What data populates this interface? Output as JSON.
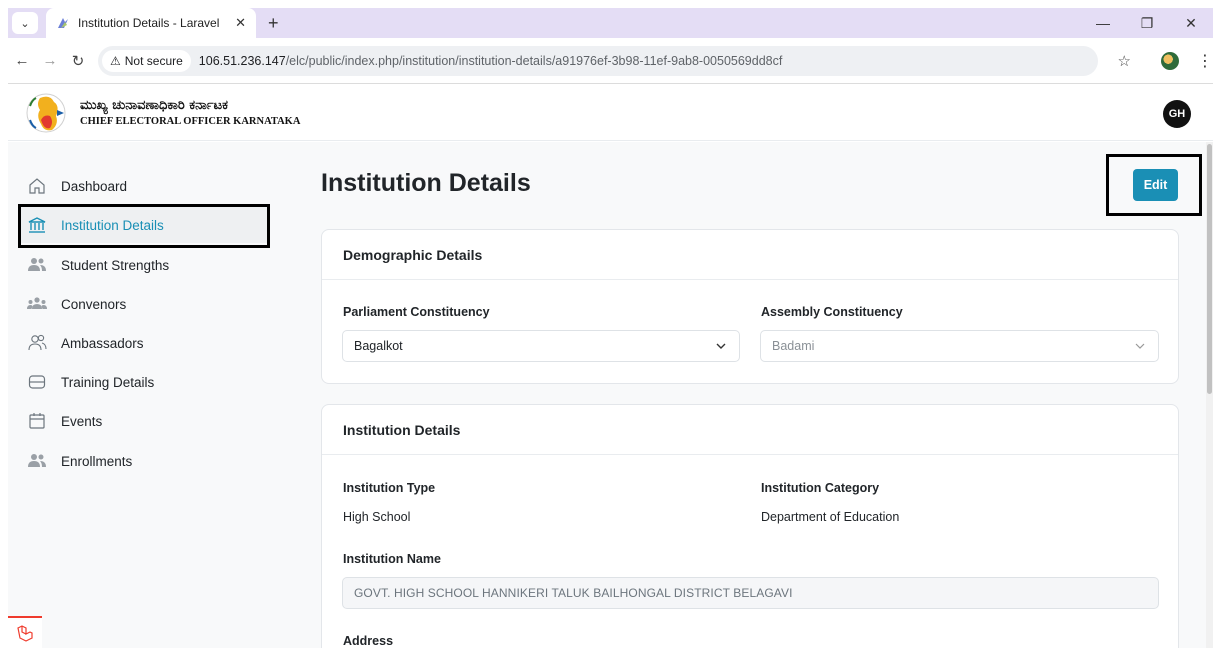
{
  "browser": {
    "tab_title": "Institution Details - Laravel",
    "security_label": "Not secure",
    "url_host": "106.51.236.147",
    "url_path": "/elc/public/index.php/institution/institution-details/a91976ef-3b98-11ef-9ab8-0050569dd8cf"
  },
  "header": {
    "logo_kannada": "ಮುಖ್ಯ ಚುನಾವಣಾಧಿಕಾರಿ ಕರ್ನಾಟಕ",
    "logo_english": "CHIEF ELECTORAL OFFICER KARNATAKA",
    "avatar_initials": "GH"
  },
  "sidebar": {
    "items": [
      {
        "label": "Dashboard",
        "icon": "home-icon"
      },
      {
        "label": "Institution Details",
        "icon": "bank-icon"
      },
      {
        "label": "Student Strengths",
        "icon": "users-icon"
      },
      {
        "label": "Convenors",
        "icon": "group-icon"
      },
      {
        "label": "Ambassadors",
        "icon": "people-outline-icon"
      },
      {
        "label": "Training Details",
        "icon": "database-icon"
      },
      {
        "label": "Events",
        "icon": "calendar-icon"
      },
      {
        "label": "Enrollments",
        "icon": "users-icon"
      }
    ],
    "active_index": 1
  },
  "main": {
    "title": "Institution Details",
    "edit_label": "Edit",
    "accent_color": "#1a8fb5",
    "demographic": {
      "heading": "Demographic Details",
      "parliament_label": "Parliament Constituency",
      "parliament_value": "Bagalkot",
      "assembly_label": "Assembly Constituency",
      "assembly_value": "Badami"
    },
    "institution": {
      "heading": "Institution Details",
      "type_label": "Institution Type",
      "type_value": "High School",
      "category_label": "Institution Category",
      "category_value": "Department of Education",
      "name_label": "Institution Name",
      "name_value": "GOVT. HIGH SCHOOL HANNIKERI TALUK BAILHONGAL DISTRICT BELAGAVI",
      "address_label": "Address"
    }
  }
}
